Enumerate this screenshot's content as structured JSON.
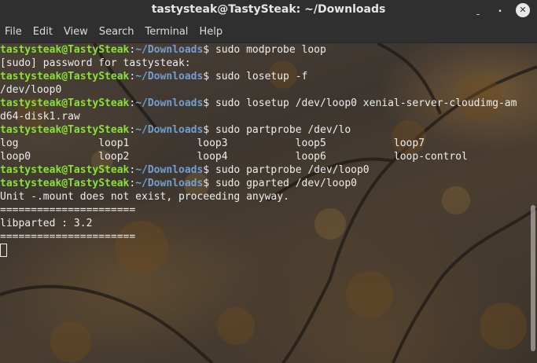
{
  "window": {
    "title": "tastysteak@TastySteak: ~/Downloads",
    "controls": [
      "minimize-icon",
      "maximize-icon",
      "close-icon"
    ]
  },
  "menu": {
    "items": [
      "File",
      "Edit",
      "View",
      "Search",
      "Terminal",
      "Help"
    ]
  },
  "terminal": {
    "prompt_user": "tastysteak@TastySteak",
    "prompt_sep": ":",
    "prompt_path": "~/Downloads",
    "prompt_end": "$ ",
    "colors": {
      "prompt_user": "#8ae234",
      "prompt_path": "#729fcf",
      "text": "#ededed"
    },
    "lines": [
      {
        "type": "prompt",
        "cmd": "sudo modprobe loop"
      },
      {
        "type": "output",
        "text": "[sudo] password for tastysteak:"
      },
      {
        "type": "prompt",
        "cmd": "sudo losetup -f"
      },
      {
        "type": "output",
        "text": "/dev/loop0"
      },
      {
        "type": "prompt",
        "cmd": "sudo losetup /dev/loop0 xenial-server-cloudimg-am"
      },
      {
        "type": "output",
        "text": "d64-disk1.raw"
      },
      {
        "type": "prompt",
        "cmd": "sudo partprobe /dev/lo"
      },
      {
        "type": "output",
        "text": "log             loop1           loop3           loop5           loop7"
      },
      {
        "type": "output",
        "text": "loop0           loop2           loop4           loop6           loop-control"
      },
      {
        "type": "prompt",
        "cmd": "sudo partprobe /dev/loop0"
      },
      {
        "type": "prompt",
        "cmd": "sudo gparted /dev/loop0"
      },
      {
        "type": "output",
        "text": "Unit -.mount does not exist, proceeding anyway."
      },
      {
        "type": "output",
        "text": "======================"
      },
      {
        "type": "output",
        "text": "libparted : 3.2"
      },
      {
        "type": "output",
        "text": "======================"
      },
      {
        "type": "cursor",
        "text": ""
      }
    ]
  }
}
